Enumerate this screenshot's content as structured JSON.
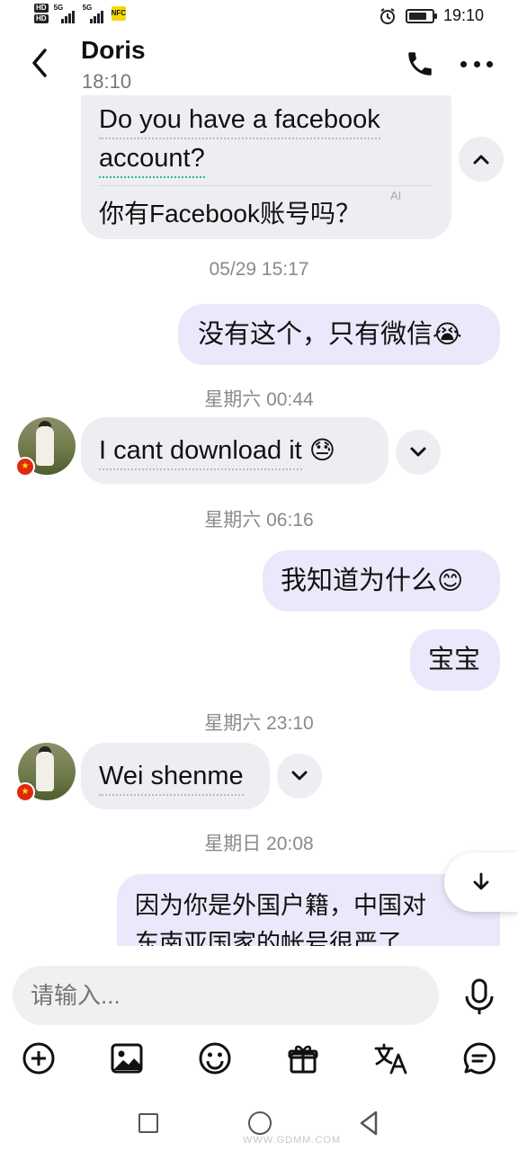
{
  "status_bar": {
    "hd1": "HD",
    "hd2": "HD",
    "signal1": "5G",
    "signal2": "5G",
    "nfc": "NFC",
    "time": "19:10",
    "battery_level": 0.8
  },
  "header": {
    "contact_name": "Doris",
    "last_seen": "18:10"
  },
  "messages": {
    "m1_line1": "Do you have a facebook",
    "m1_line2": "account?",
    "m1_translation": "你有Facebook账号吗？",
    "m1_ai": "AI",
    "ts1": "05/29 15:17",
    "m2": "没有这个，只有微信",
    "m2_emoji": "😭",
    "ts2": "星期六 00:44",
    "m3": "I cant download it",
    "m3_emoji": "😓",
    "ts3": "星期六 06:16",
    "m4": "我知道为什么",
    "m4_emoji": "😊",
    "m5": "宝宝",
    "ts4": "星期六 23:10",
    "m6": "Wei shenme",
    "ts5": "星期日 20:08",
    "m7_line1": "因为你是外国户籍，中国对",
    "m7_line2": "东南亚国家的帐号很严了"
  },
  "input": {
    "placeholder": "请输入..."
  },
  "watermark": "WWW.GDMM.COM"
}
